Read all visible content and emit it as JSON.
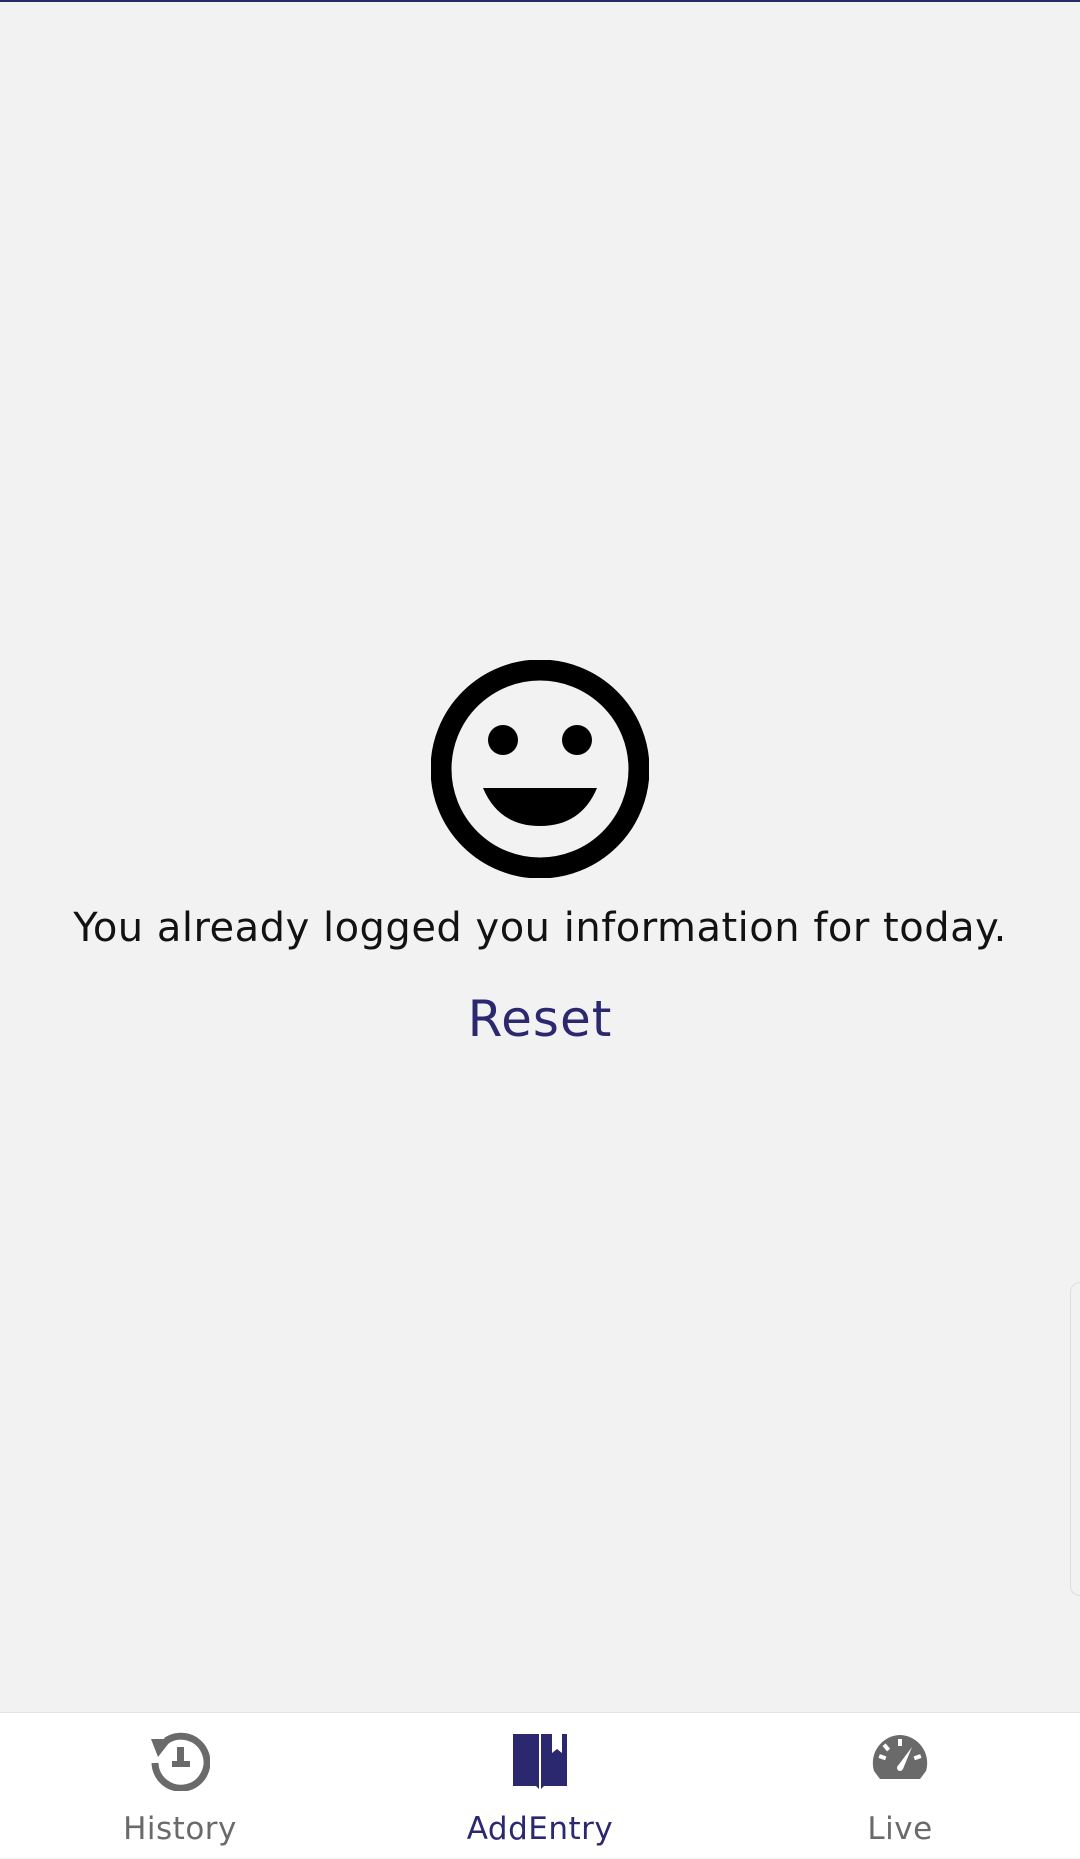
{
  "message": "You already logged you information for today.",
  "reset_label": "Reset",
  "nav": {
    "items": [
      {
        "label": "History",
        "icon": "history-icon",
        "active": false
      },
      {
        "label": "AddEntry",
        "icon": "book-icon",
        "active": true
      },
      {
        "label": "Live",
        "icon": "speedometer-icon",
        "active": false
      }
    ]
  },
  "colors": {
    "background": "#f2f2f2",
    "accent": "#2c2870",
    "inactive": "#6a6a6a",
    "nav_background": "#ffffff"
  }
}
